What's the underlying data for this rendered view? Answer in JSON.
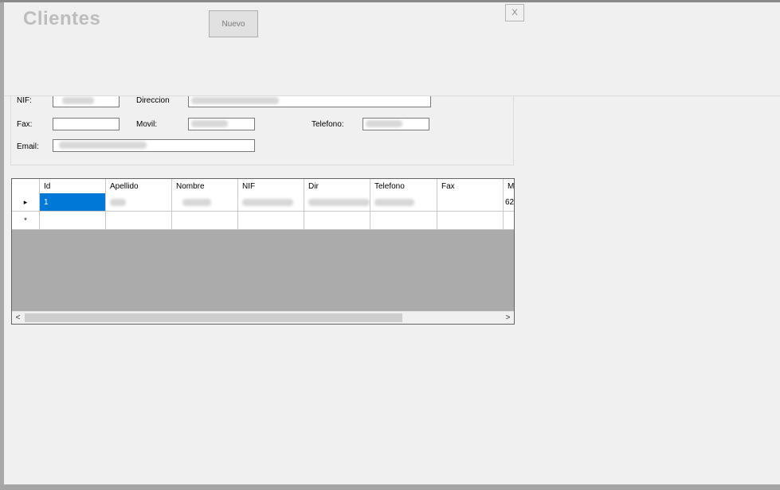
{
  "window": {
    "title": "Clientes",
    "new_button": "Nuevo",
    "close_button": "X"
  },
  "form": {
    "nif": {
      "label": "NIF:"
    },
    "direccion": {
      "label": "Direccion"
    },
    "fax": {
      "label": "Fax:",
      "value": ""
    },
    "movil": {
      "label": "Movil:"
    },
    "telefono": {
      "label": "Telefono:"
    },
    "email": {
      "label": "Email:"
    }
  },
  "grid": {
    "columns": [
      "Id",
      "Apellido",
      "Nombre",
      "NIF",
      "Dir",
      "Telefono",
      "Fax",
      "M"
    ],
    "rows": [
      {
        "indicator": "▸",
        "id": "1",
        "movil": "62"
      }
    ],
    "new_row_indicator": "*",
    "scroll_left": "<",
    "scroll_right": ">"
  }
}
